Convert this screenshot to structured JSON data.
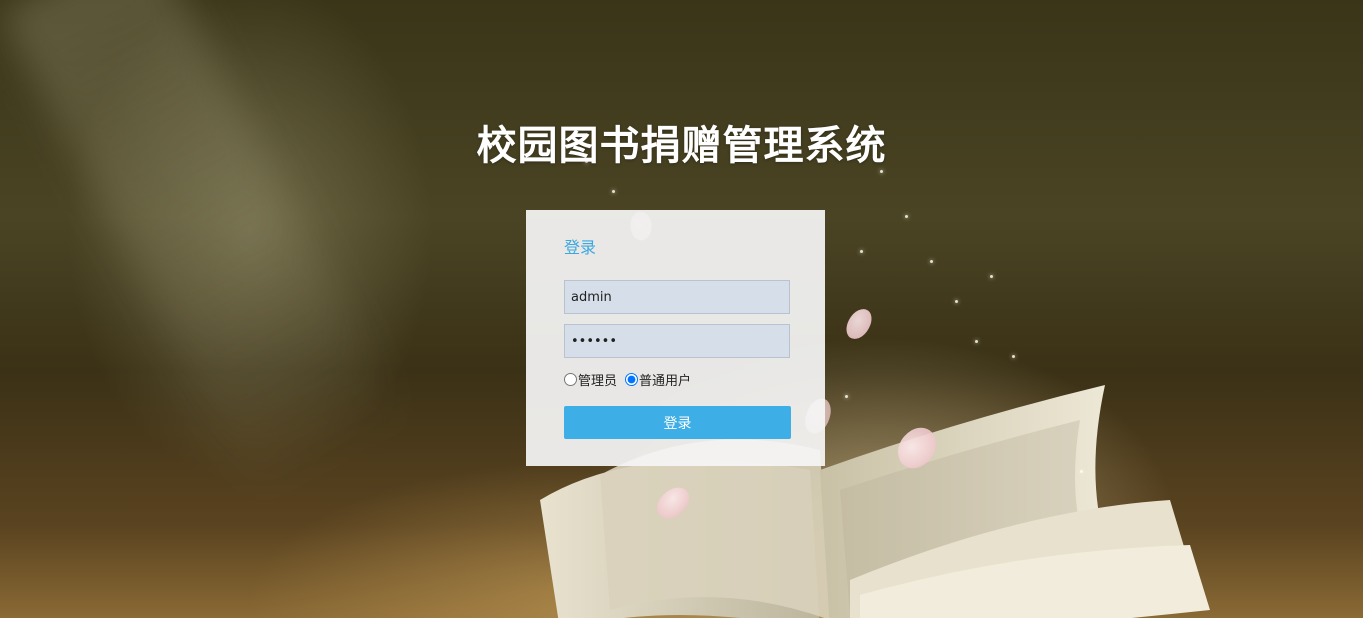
{
  "page": {
    "title": "校园图书捐赠管理系统"
  },
  "login": {
    "heading": "登录",
    "username_value": "admin",
    "password_value": "123456",
    "roles": [
      {
        "label": "管理员",
        "checked": false
      },
      {
        "label": "普通用户",
        "checked": true
      }
    ],
    "submit_label": "登录"
  },
  "colors": {
    "accent": "#3eaee6",
    "heading": "#3aa8e0",
    "input_bg": "#d6dfe9"
  }
}
